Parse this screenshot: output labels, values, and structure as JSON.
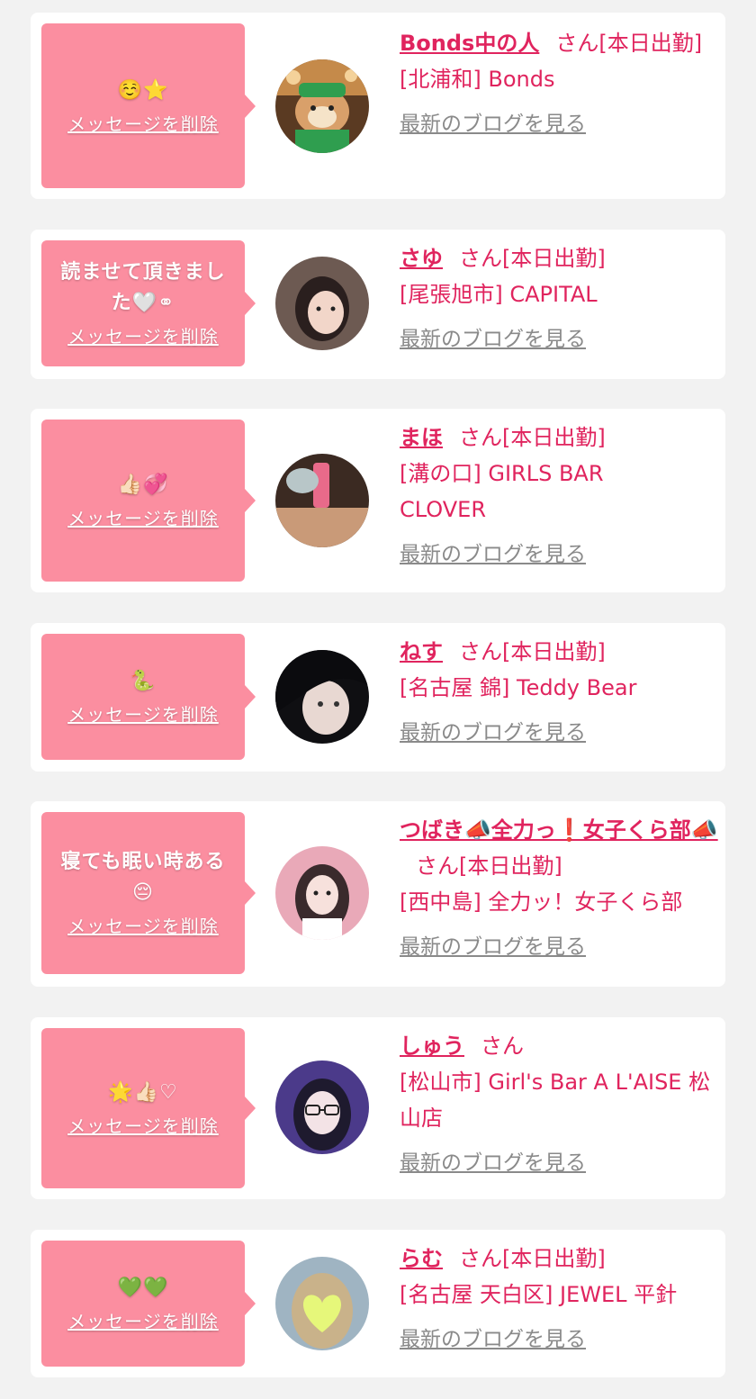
{
  "colors": {
    "accent": "#e0245e",
    "bubble": "#fb8ea0",
    "card": "#ffffff",
    "background": "#f2f2f2",
    "link_gray": "#8a8a8a"
  },
  "delete_label": "メッセージを削除",
  "blog_label": "最新のブログを見る",
  "items": [
    {
      "message": "☺️⭐",
      "name": "Bonds中の人",
      "suffix": "さん[本日出勤]",
      "shop": "[北浦和] Bonds",
      "avatar": "bonds-mascot"
    },
    {
      "message": "読ませて頂きました🤍⚭",
      "name": "さゆ",
      "suffix": "さん[本日出勤]",
      "shop": "[尾張旭市] CAPITAL",
      "avatar": "user-photo"
    },
    {
      "message": "👍🏻💞",
      "name": "まほ",
      "suffix": "さん[本日出勤]",
      "shop": "[溝の口] GIRLS BAR CLOVER",
      "avatar": "user-photo"
    },
    {
      "message": "🐍",
      "name": "ねす",
      "suffix": "さん[本日出勤]",
      "shop": "[名古屋 錦] Teddy Bear",
      "avatar": "user-photo"
    },
    {
      "message": "寝ても眠い時ある😔",
      "name": "つばき📣全力っ❗女子くら部📣",
      "suffix": "さん[本日出勤]",
      "shop": "[西中島] 全力ッ！女子くら部",
      "avatar": "user-photo"
    },
    {
      "message": "🌟👍🏻♡",
      "name": "しゅう",
      "suffix": "さん",
      "shop": "[松山市] Girl's Bar A L'AISE 松山店",
      "avatar": "user-photo"
    },
    {
      "message": "💚💚",
      "name": "らむ",
      "suffix": "さん[本日出勤]",
      "shop": "[名古屋 天白区] JEWEL 平針",
      "avatar": "user-photo"
    }
  ]
}
